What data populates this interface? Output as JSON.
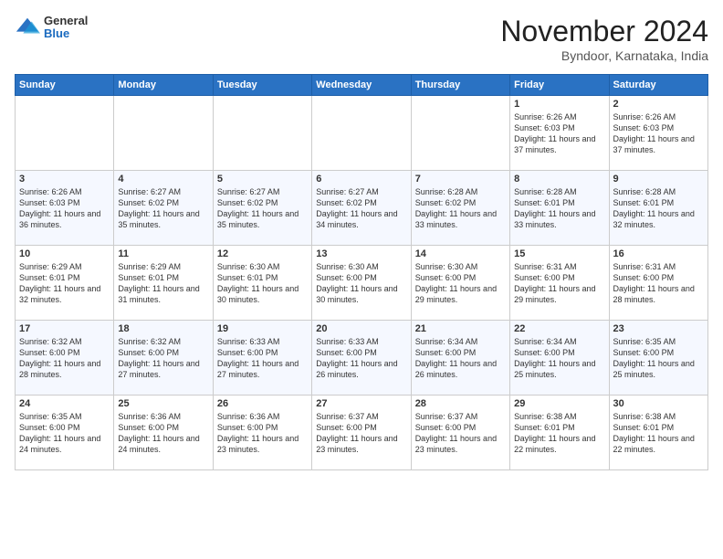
{
  "header": {
    "logo": {
      "general": "General",
      "blue": "Blue"
    },
    "title": "November 2024",
    "location": "Byndoor, Karnataka, India"
  },
  "calendar": {
    "days_of_week": [
      "Sunday",
      "Monday",
      "Tuesday",
      "Wednesday",
      "Thursday",
      "Friday",
      "Saturday"
    ],
    "weeks": [
      [
        {
          "day": "",
          "info": ""
        },
        {
          "day": "",
          "info": ""
        },
        {
          "day": "",
          "info": ""
        },
        {
          "day": "",
          "info": ""
        },
        {
          "day": "",
          "info": ""
        },
        {
          "day": "1",
          "info": "Sunrise: 6:26 AM\nSunset: 6:03 PM\nDaylight: 11 hours and 37 minutes."
        },
        {
          "day": "2",
          "info": "Sunrise: 6:26 AM\nSunset: 6:03 PM\nDaylight: 11 hours and 37 minutes."
        }
      ],
      [
        {
          "day": "3",
          "info": "Sunrise: 6:26 AM\nSunset: 6:03 PM\nDaylight: 11 hours and 36 minutes."
        },
        {
          "day": "4",
          "info": "Sunrise: 6:27 AM\nSunset: 6:02 PM\nDaylight: 11 hours and 35 minutes."
        },
        {
          "day": "5",
          "info": "Sunrise: 6:27 AM\nSunset: 6:02 PM\nDaylight: 11 hours and 35 minutes."
        },
        {
          "day": "6",
          "info": "Sunrise: 6:27 AM\nSunset: 6:02 PM\nDaylight: 11 hours and 34 minutes."
        },
        {
          "day": "7",
          "info": "Sunrise: 6:28 AM\nSunset: 6:02 PM\nDaylight: 11 hours and 33 minutes."
        },
        {
          "day": "8",
          "info": "Sunrise: 6:28 AM\nSunset: 6:01 PM\nDaylight: 11 hours and 33 minutes."
        },
        {
          "day": "9",
          "info": "Sunrise: 6:28 AM\nSunset: 6:01 PM\nDaylight: 11 hours and 32 minutes."
        }
      ],
      [
        {
          "day": "10",
          "info": "Sunrise: 6:29 AM\nSunset: 6:01 PM\nDaylight: 11 hours and 32 minutes."
        },
        {
          "day": "11",
          "info": "Sunrise: 6:29 AM\nSunset: 6:01 PM\nDaylight: 11 hours and 31 minutes."
        },
        {
          "day": "12",
          "info": "Sunrise: 6:30 AM\nSunset: 6:01 PM\nDaylight: 11 hours and 30 minutes."
        },
        {
          "day": "13",
          "info": "Sunrise: 6:30 AM\nSunset: 6:00 PM\nDaylight: 11 hours and 30 minutes."
        },
        {
          "day": "14",
          "info": "Sunrise: 6:30 AM\nSunset: 6:00 PM\nDaylight: 11 hours and 29 minutes."
        },
        {
          "day": "15",
          "info": "Sunrise: 6:31 AM\nSunset: 6:00 PM\nDaylight: 11 hours and 29 minutes."
        },
        {
          "day": "16",
          "info": "Sunrise: 6:31 AM\nSunset: 6:00 PM\nDaylight: 11 hours and 28 minutes."
        }
      ],
      [
        {
          "day": "17",
          "info": "Sunrise: 6:32 AM\nSunset: 6:00 PM\nDaylight: 11 hours and 28 minutes."
        },
        {
          "day": "18",
          "info": "Sunrise: 6:32 AM\nSunset: 6:00 PM\nDaylight: 11 hours and 27 minutes."
        },
        {
          "day": "19",
          "info": "Sunrise: 6:33 AM\nSunset: 6:00 PM\nDaylight: 11 hours and 27 minutes."
        },
        {
          "day": "20",
          "info": "Sunrise: 6:33 AM\nSunset: 6:00 PM\nDaylight: 11 hours and 26 minutes."
        },
        {
          "day": "21",
          "info": "Sunrise: 6:34 AM\nSunset: 6:00 PM\nDaylight: 11 hours and 26 minutes."
        },
        {
          "day": "22",
          "info": "Sunrise: 6:34 AM\nSunset: 6:00 PM\nDaylight: 11 hours and 25 minutes."
        },
        {
          "day": "23",
          "info": "Sunrise: 6:35 AM\nSunset: 6:00 PM\nDaylight: 11 hours and 25 minutes."
        }
      ],
      [
        {
          "day": "24",
          "info": "Sunrise: 6:35 AM\nSunset: 6:00 PM\nDaylight: 11 hours and 24 minutes."
        },
        {
          "day": "25",
          "info": "Sunrise: 6:36 AM\nSunset: 6:00 PM\nDaylight: 11 hours and 24 minutes."
        },
        {
          "day": "26",
          "info": "Sunrise: 6:36 AM\nSunset: 6:00 PM\nDaylight: 11 hours and 23 minutes."
        },
        {
          "day": "27",
          "info": "Sunrise: 6:37 AM\nSunset: 6:00 PM\nDaylight: 11 hours and 23 minutes."
        },
        {
          "day": "28",
          "info": "Sunrise: 6:37 AM\nSunset: 6:00 PM\nDaylight: 11 hours and 23 minutes."
        },
        {
          "day": "29",
          "info": "Sunrise: 6:38 AM\nSunset: 6:01 PM\nDaylight: 11 hours and 22 minutes."
        },
        {
          "day": "30",
          "info": "Sunrise: 6:38 AM\nSunset: 6:01 PM\nDaylight: 11 hours and 22 minutes."
        }
      ]
    ]
  }
}
